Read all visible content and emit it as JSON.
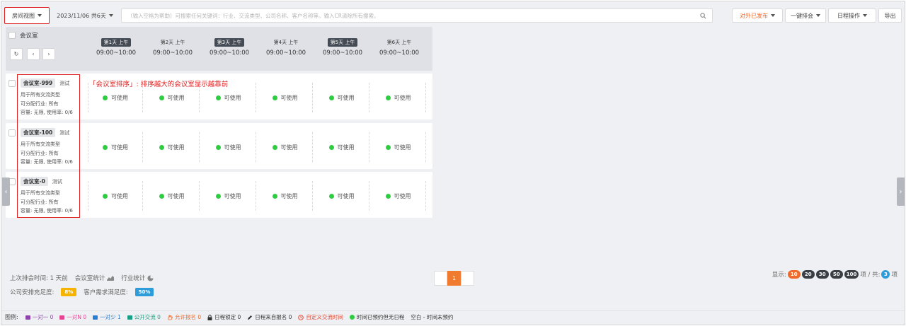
{
  "toolbar": {
    "view_label": "房间视图",
    "date_label": "2023/11/06 共6天",
    "search_placeholder": "（输入空格为帮助）可搜索任何关键词：行业、交流类型、公司名称、客户名称等。输入CR清除所有搜索。",
    "publish_label": "对外已发布",
    "auto_label": "一键排会",
    "schedule_label": "日程操作",
    "export_label": "导出"
  },
  "grid": {
    "header_title": "会议室",
    "nav_refresh": "↻",
    "nav_prev": "‹",
    "nav_next": "›",
    "days": [
      {
        "label": "第1天 上午",
        "time": "09:00~10:00",
        "active": true
      },
      {
        "label": "第2天 上午",
        "time": "09:00~10:00",
        "active": false
      },
      {
        "label": "第3天 上午",
        "time": "09:00~10:00",
        "active": true
      },
      {
        "label": "第4天 上午",
        "time": "09:00~10:00",
        "active": false
      },
      {
        "label": "第5天 上午",
        "time": "09:00~10:00",
        "active": true
      },
      {
        "label": "第6天 上午",
        "time": "09:00~10:00",
        "active": false
      }
    ],
    "rooms": [
      {
        "name": "会议室-999",
        "sub": "测试",
        "line1": "用于所有交流类型",
        "line2": "可分配行业: 所有",
        "line3": "容量: 无限, 使用率: 0/6"
      },
      {
        "name": "会议室-100",
        "sub": "测试",
        "line1": "用于所有交流类型",
        "line2": "可分配行业: 所有",
        "line3": "容量: 无限, 使用率: 0/6"
      },
      {
        "name": "会议室-0",
        "sub": "测试",
        "line1": "用于所有交流类型",
        "line2": "可分配行业: 所有",
        "line3": "容量: 无限, 使用率: 0/6"
      }
    ],
    "slot_label": "可使用",
    "annotation": "「会议室排序」: 排序越大的会议室显示越靠前"
  },
  "footer": {
    "last_sched": "上次排会时间: 1 天前",
    "room_stats": "会议室统计",
    "industry_stats": "行业统计",
    "company_fill_label": "公司安排充足度:",
    "company_fill_value": "8%",
    "client_fill_label": "客户需求满足度:",
    "client_fill_value": "50%",
    "page_current": "1",
    "show_label": "显示:",
    "page_sizes": [
      "10",
      "20",
      "30",
      "50",
      "100"
    ],
    "items_label": "项 / 共:",
    "total": "3",
    "total_suffix": "项"
  },
  "legend": {
    "title": "图例:",
    "items": [
      {
        "label": "一对一 0",
        "color": "#8e44ad"
      },
      {
        "label": "一对N 0",
        "color": "#e84393"
      },
      {
        "label": "一对少 1",
        "color": "#2d7dd2"
      },
      {
        "label": "公开交流 0",
        "color": "#16a085"
      }
    ],
    "allow_signup": "允许报名 0",
    "locked": "日程锁定 0",
    "self_signup": "日程来自报名 0",
    "custom_time": "自定义交流时间",
    "booked_no_sched": "时间已预约但无日程",
    "blank": "空白 - 时间未预约"
  }
}
